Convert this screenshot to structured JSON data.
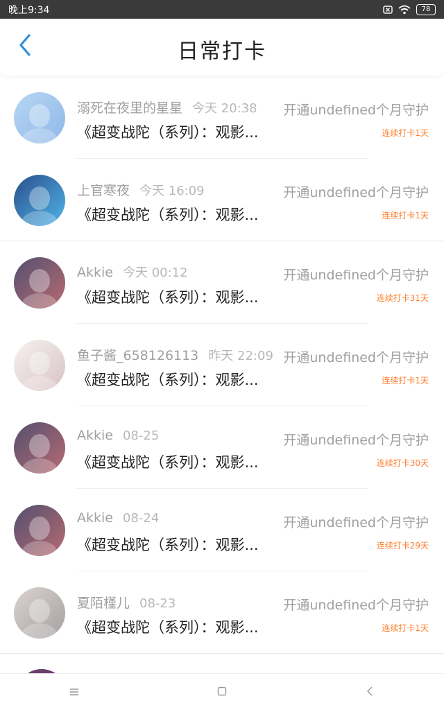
{
  "status_bar": {
    "time": "晚上9:34",
    "battery": "78",
    "icons": [
      "sim-x-icon",
      "wifi-icon",
      "battery-icon"
    ]
  },
  "header": {
    "title": "日常打卡",
    "back_icon": "chevron-left-icon",
    "accent": "#2f8fdc"
  },
  "items": [
    {
      "name": "溺死在夜里的星星",
      "time": "今天 20:38",
      "content": "《超变战陀（系列）：观影...",
      "guard": "开通undefined个月守护",
      "streak": "连续打卡1天",
      "avatar_colors": [
        "#b7d6f3",
        "#8fb8e8"
      ]
    },
    {
      "name": "上官寒夜",
      "time": "今天 16:09",
      "content": "《超变战陀（系列）：观影...",
      "guard": "开通undefined个月守护",
      "streak": "连续打卡1天",
      "avatar_colors": [
        "#2a4f8c",
        "#4fb4e8"
      ]
    },
    {
      "name": "Akkie",
      "time": "今天 00:12",
      "content": "《超变战陀（系列）：观影...",
      "guard": "开通undefined个月守护",
      "streak": "连续打卡31天",
      "avatar_colors": [
        "#53506f",
        "#b86a72"
      ]
    },
    {
      "name": "鱼子酱_658126113",
      "time": "昨天 22:09",
      "content": "《超变战陀（系列）：观影...",
      "guard": "开通undefined个月守护",
      "streak": "连续打卡1天",
      "avatar_colors": [
        "#f6f2f0",
        "#d8c2c6"
      ]
    },
    {
      "name": "Akkie",
      "time": "08-25",
      "content": "《超变战陀（系列）：观影...",
      "guard": "开通undefined个月守护",
      "streak": "连续打卡30天",
      "avatar_colors": [
        "#53506f",
        "#b86a72"
      ]
    },
    {
      "name": "Akkie",
      "time": "08-24",
      "content": "《超变战陀（系列）：观影...",
      "guard": "开通undefined个月守护",
      "streak": "连续打卡29天",
      "avatar_colors": [
        "#53506f",
        "#b86a72"
      ]
    },
    {
      "name": "夏陌槿儿",
      "time": "08-23",
      "content": "《超变战陀（系列）：观影...",
      "guard": "开通undefined个月守护",
      "streak": "连续打卡1天",
      "avatar_colors": [
        "#d9d3d1",
        "#a79fa0"
      ]
    }
  ],
  "colors": {
    "streak": "#ff7e2d",
    "meta": "#a0a0a0",
    "content": "#222222"
  },
  "nav_bar": {
    "icons": [
      "menu-icon",
      "home-square-icon",
      "back-arrow-icon"
    ]
  }
}
